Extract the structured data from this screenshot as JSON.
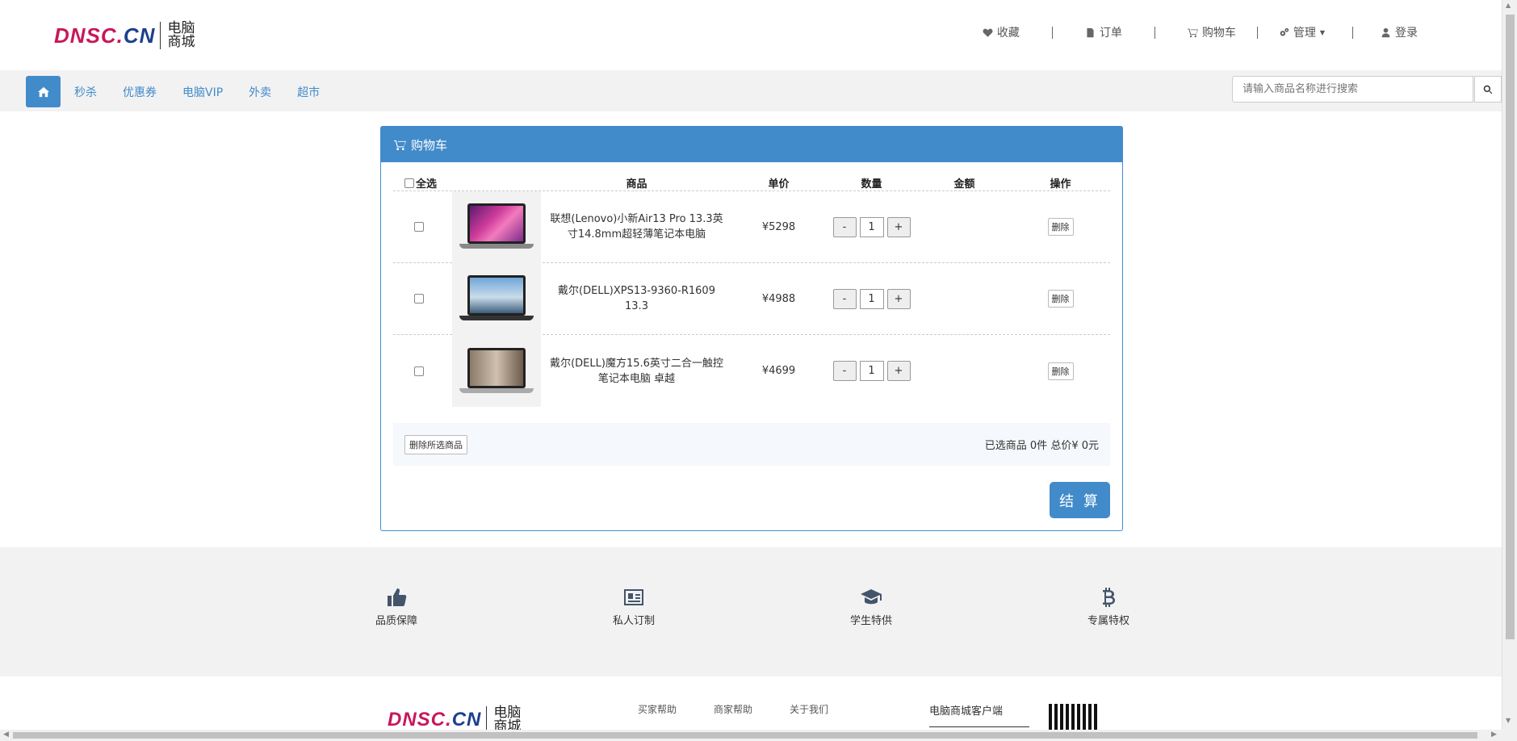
{
  "brand": {
    "logo_a": "DNSC",
    "logo_dot": ".",
    "logo_b": "CN",
    "logo_cn": "电脑商城"
  },
  "top_nav": {
    "favorites": "收藏",
    "orders": "订单",
    "cart": "购物车",
    "manage": "管理",
    "login": "登录"
  },
  "nav": {
    "links": [
      "秒杀",
      "优惠券",
      "电脑VIP",
      "外卖",
      "超市"
    ],
    "search_placeholder": "请输入商品名称进行搜索"
  },
  "cart": {
    "title": "购物车",
    "headers": {
      "select_all": "全选",
      "product": "商品",
      "unit_price": "单价",
      "quantity": "数量",
      "amount": "金额",
      "action": "操作"
    },
    "items": [
      {
        "name": "联想(Lenovo)小新Air13 Pro 13.3英寸14.8mm超轻薄笔记本电脑",
        "price": "¥5298",
        "qty": "1",
        "delete": "删除"
      },
      {
        "name": "戴尔(DELL)XPS13-9360-R1609 13.3",
        "price": "¥4988",
        "qty": "1",
        "delete": "删除"
      },
      {
        "name": "戴尔(DELL)魔方15.6英寸二合一触控笔记本电脑 卓越",
        "price": "¥4699",
        "qty": "1",
        "delete": "删除"
      }
    ],
    "minus": "-",
    "plus": "+",
    "delete_selected": "删除所选商品",
    "summary": "已选商品 0件 总价¥ 0元",
    "checkout": "结 算"
  },
  "features": [
    "品质保障",
    "私人订制",
    "学生特供",
    "专属特权"
  ],
  "footer": {
    "links": [
      "买家帮助",
      "商家帮助",
      "关于我们"
    ],
    "client": "电脑商城客户端"
  },
  "colors": {
    "primary": "#428bca",
    "logo_red": "#c8175a",
    "logo_blue": "#1c3f8f"
  }
}
